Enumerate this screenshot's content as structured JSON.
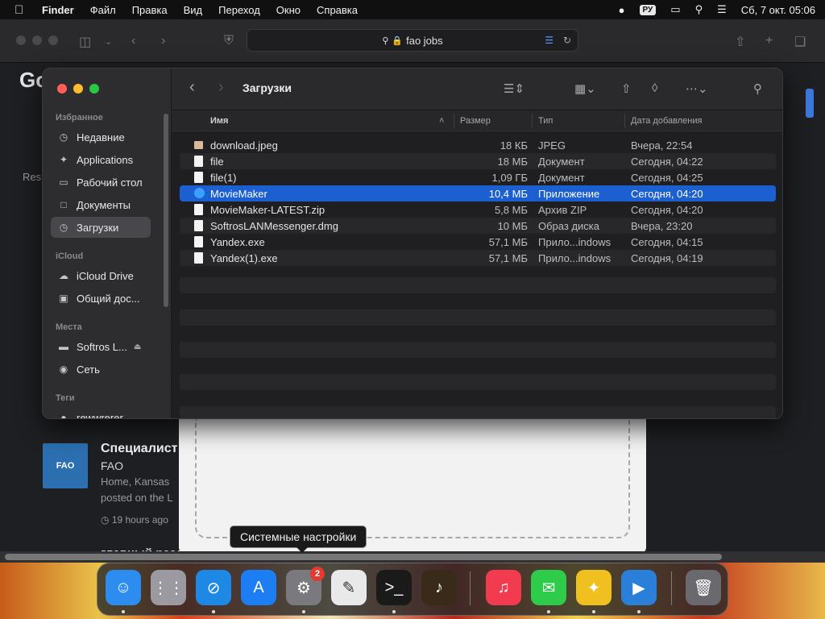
{
  "menubar": {
    "app": "Finder",
    "items": [
      "Файл",
      "Правка",
      "Вид",
      "Переход",
      "Окно",
      "Справка"
    ],
    "lang": "РУ",
    "clock": "Сб, 7 окт.  05:06"
  },
  "safari": {
    "address": "fao jobs",
    "page_heading_partial": "Go",
    "results_label": "Res",
    "job": {
      "logo_text": "FAO",
      "title": "Специалист п",
      "org": "FAO",
      "location": "Home, Kansas",
      "posted": "posted on the L",
      "time": "19 hours ago"
    },
    "section_title": "главный раздел"
  },
  "finder": {
    "title": "Загрузки",
    "sidebar": {
      "favorites_label": "Избранное",
      "favorites": [
        {
          "label": "Недавние",
          "icon": "clock-icon"
        },
        {
          "label": "Applications",
          "icon": "applications-icon"
        },
        {
          "label": "Рабочий стол",
          "icon": "desktop-icon"
        },
        {
          "label": "Документы",
          "icon": "document-icon"
        },
        {
          "label": "Загрузки",
          "icon": "downloads-icon"
        }
      ],
      "icloud_label": "iCloud",
      "icloud": [
        {
          "label": "iCloud Drive",
          "icon": "cloud-icon"
        },
        {
          "label": "Общий дос...",
          "icon": "shared-folder-icon"
        }
      ],
      "places_label": "Места",
      "places": [
        {
          "label": "Softros L...",
          "icon": "disk-icon"
        },
        {
          "label": "Сеть",
          "icon": "network-icon"
        }
      ],
      "tags_label": "Теги",
      "tags": [
        {
          "label": "rewwrerer",
          "icon": "tag-dot-icon"
        }
      ]
    },
    "columns": {
      "name": "Имя",
      "size": "Размер",
      "kind": "Тип",
      "date": "Дата добавления"
    },
    "files": [
      {
        "name": "download.jpeg",
        "size": "18 КБ",
        "kind": "JPEG",
        "date": "Вчера, 22:54",
        "type": "img"
      },
      {
        "name": "file",
        "size": "18 МБ",
        "kind": "Документ",
        "date": "Сегодня, 04:22",
        "type": "doc"
      },
      {
        "name": "file(1)",
        "size": "1,09 ГБ",
        "kind": "Документ",
        "date": "Сегодня, 04:25",
        "type": "doc"
      },
      {
        "name": "MovieMaker",
        "size": "10,4 МБ",
        "kind": "Приложение",
        "date": "Сегодня, 04:20",
        "type": "app"
      },
      {
        "name": "MovieMaker-LATEST.zip",
        "size": "5,8 МБ",
        "kind": "Архив ZIP",
        "date": "Сегодня, 04:20",
        "type": "doc"
      },
      {
        "name": "SoftrosLANMessenger.dmg",
        "size": "10 МБ",
        "kind": "Образ диска",
        "date": "Вчера, 23:20",
        "type": "doc"
      },
      {
        "name": "Yandex.exe",
        "size": "57,1 МБ",
        "kind": "Прило...indows",
        "date": "Сегодня, 04:15",
        "type": "doc"
      },
      {
        "name": "Yandex(1).exe",
        "size": "57,1 МБ",
        "kind": "Прило...indows",
        "date": "Сегодня, 04:19",
        "type": "doc"
      }
    ],
    "selected_row": 3
  },
  "tooltip": "Системные настройки",
  "dock": {
    "apps": [
      {
        "name": "finder-icon",
        "color": "#2d8cf0",
        "glyph": "☺"
      },
      {
        "name": "launchpad-icon",
        "color": "#9a9aa0",
        "glyph": "⋮⋮"
      },
      {
        "name": "safari-icon",
        "color": "#1e88e5",
        "glyph": "⊘"
      },
      {
        "name": "app-store-icon",
        "color": "#1c7ef2",
        "glyph": "A"
      },
      {
        "name": "system-settings-icon",
        "color": "#7a7a7e",
        "glyph": "⚙",
        "badge": "2"
      },
      {
        "name": "textedit-icon",
        "color": "#e9e9e9",
        "glyph": "✎"
      },
      {
        "name": "terminal-icon",
        "color": "#1a1a1a",
        "glyph": ">_"
      },
      {
        "name": "garageband-icon",
        "color": "#3a2a1a",
        "glyph": "♪"
      },
      {
        "name": "music-icon",
        "color": "#f23b4f",
        "glyph": "♫"
      },
      {
        "name": "messages-icon",
        "color": "#2ecc4a",
        "glyph": "✉"
      },
      {
        "name": "softros-messenger-icon",
        "color": "#f0c020",
        "glyph": "✦"
      },
      {
        "name": "moviemaker-icon",
        "color": "#2a7fd8",
        "glyph": "▶"
      },
      {
        "name": "trash-icon",
        "color": "#6a6a6e",
        "glyph": "🗑"
      }
    ]
  }
}
